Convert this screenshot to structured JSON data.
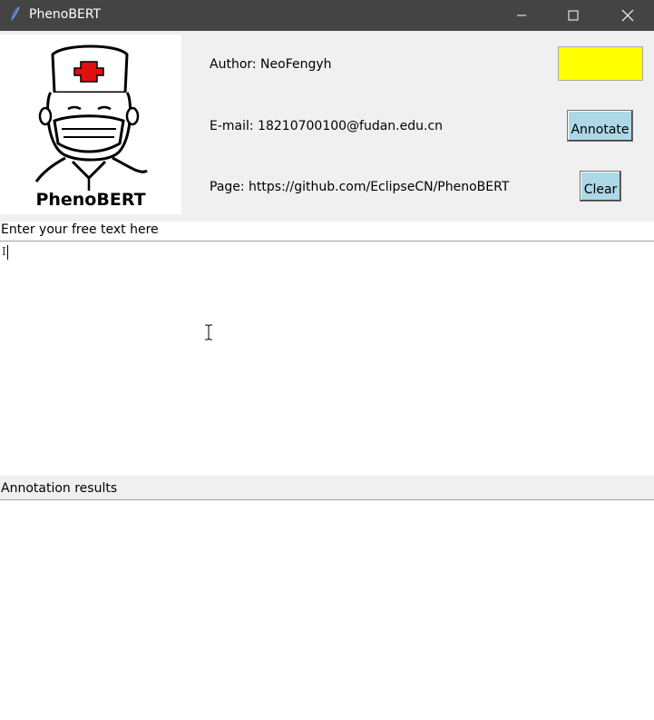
{
  "window": {
    "title": "PhenoBERT",
    "controls": {
      "minimize_icon": "minimize-icon",
      "maximize_icon": "maximize-icon",
      "close_icon": "close-icon"
    },
    "colors": {
      "titlebar": "#444444",
      "background": "#f0f0f0"
    }
  },
  "header": {
    "logo_text": "PhenoBERT",
    "author": "Author: NeoFengyh",
    "email": "E-mail: 18210700100@fudan.edu.cn",
    "page": "Page: https://github.com/EclipseCN/PhenoBERT",
    "status_color": "#ffff00",
    "annotate_label": "Annotate",
    "clear_label": "Clear",
    "button_color": "#add8e6"
  },
  "input_section": {
    "label": "Enter your free text here",
    "value": "",
    "caret_glyph": "I"
  },
  "results_section": {
    "label": "Annotation results",
    "value": ""
  }
}
